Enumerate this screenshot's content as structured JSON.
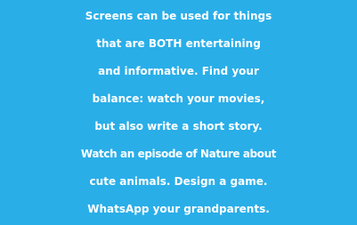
{
  "background_color": "#29aee8",
  "text_color": "#ffffff",
  "message": {
    "lines": [
      "Screens can be used for things",
      "that are BOTH entertaining",
      "and informative. Find your",
      "balance: watch your movies,",
      "but also write a short story.",
      "Watch an episode of Nature about",
      "cute animals. Design a game.",
      "WhatsApp your grandparents."
    ]
  }
}
